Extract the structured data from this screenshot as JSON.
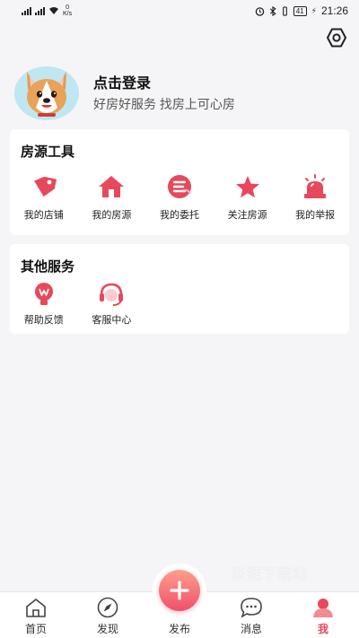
{
  "status_bar": {
    "speed_value": "0",
    "speed_unit": "K/s",
    "battery": "41",
    "time": "21:26"
  },
  "settings": {
    "icon": "settings-icon"
  },
  "profile": {
    "avatar": "corgi-avatar",
    "title": "点击登录",
    "subtitle": "好房好服务 找房上可心房"
  },
  "tools": {
    "title": "房源工具",
    "items": [
      {
        "label": "我的店铺",
        "icon": "tag-icon"
      },
      {
        "label": "我的房源",
        "icon": "house-icon"
      },
      {
        "label": "我的委托",
        "icon": "entrust-icon"
      },
      {
        "label": "关注房源",
        "icon": "star-icon"
      },
      {
        "label": "我的举报",
        "icon": "alarm-icon"
      }
    ]
  },
  "services": {
    "title": "其他服务",
    "items": [
      {
        "label": "帮助反馈",
        "icon": "lightbulb-icon"
      },
      {
        "label": "客服中心",
        "icon": "headset-icon"
      }
    ]
  },
  "watermark": "沃捷下载站",
  "tab_bar": {
    "items": [
      {
        "label": "首页",
        "icon": "home-icon"
      },
      {
        "label": "发现",
        "icon": "compass-icon"
      },
      {
        "label": "发布",
        "icon": "plus-icon"
      },
      {
        "label": "消息",
        "icon": "chat-icon"
      },
      {
        "label": "我",
        "icon": "user-icon",
        "active": true
      }
    ]
  },
  "colors": {
    "accent": "#e8485c",
    "background": "#f5f5f7"
  }
}
